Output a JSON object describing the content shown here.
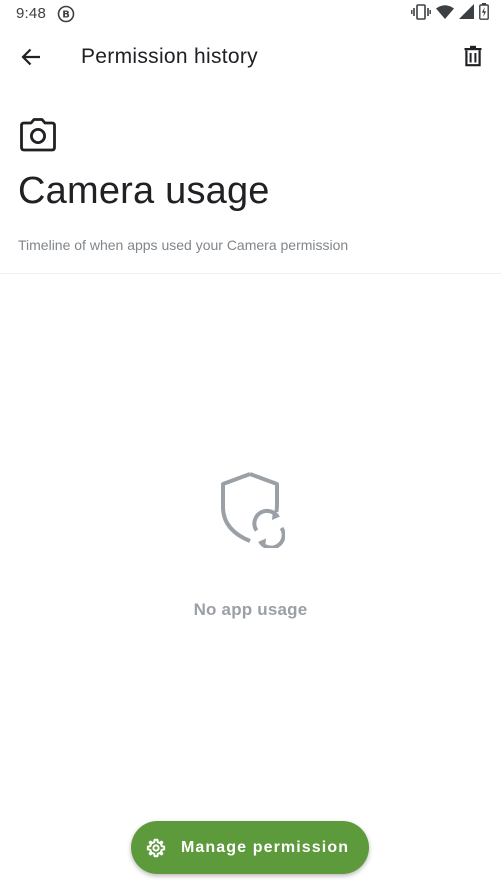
{
  "status_bar": {
    "time": "9:48",
    "icons": [
      "sync-icon",
      "vibrate-icon",
      "wifi-icon",
      "signal-icon",
      "battery-icon"
    ]
  },
  "app_bar": {
    "title": "Permission history",
    "icons": [
      "back-arrow-icon",
      "delete-icon"
    ]
  },
  "header": {
    "icon": "camera-icon",
    "title": "Camera usage",
    "subtitle": "Timeline of when apps used your Camera permission"
  },
  "empty_state": {
    "icon": "shield-sync-icon",
    "message": "No app usage"
  },
  "fab": {
    "icon": "gear-icon",
    "label": "Manage permission"
  },
  "colors": {
    "accent": "#5c9a3b",
    "title_text": "#202124",
    "secondary_text": "#80868b",
    "empty_text": "#9aa0a6"
  }
}
